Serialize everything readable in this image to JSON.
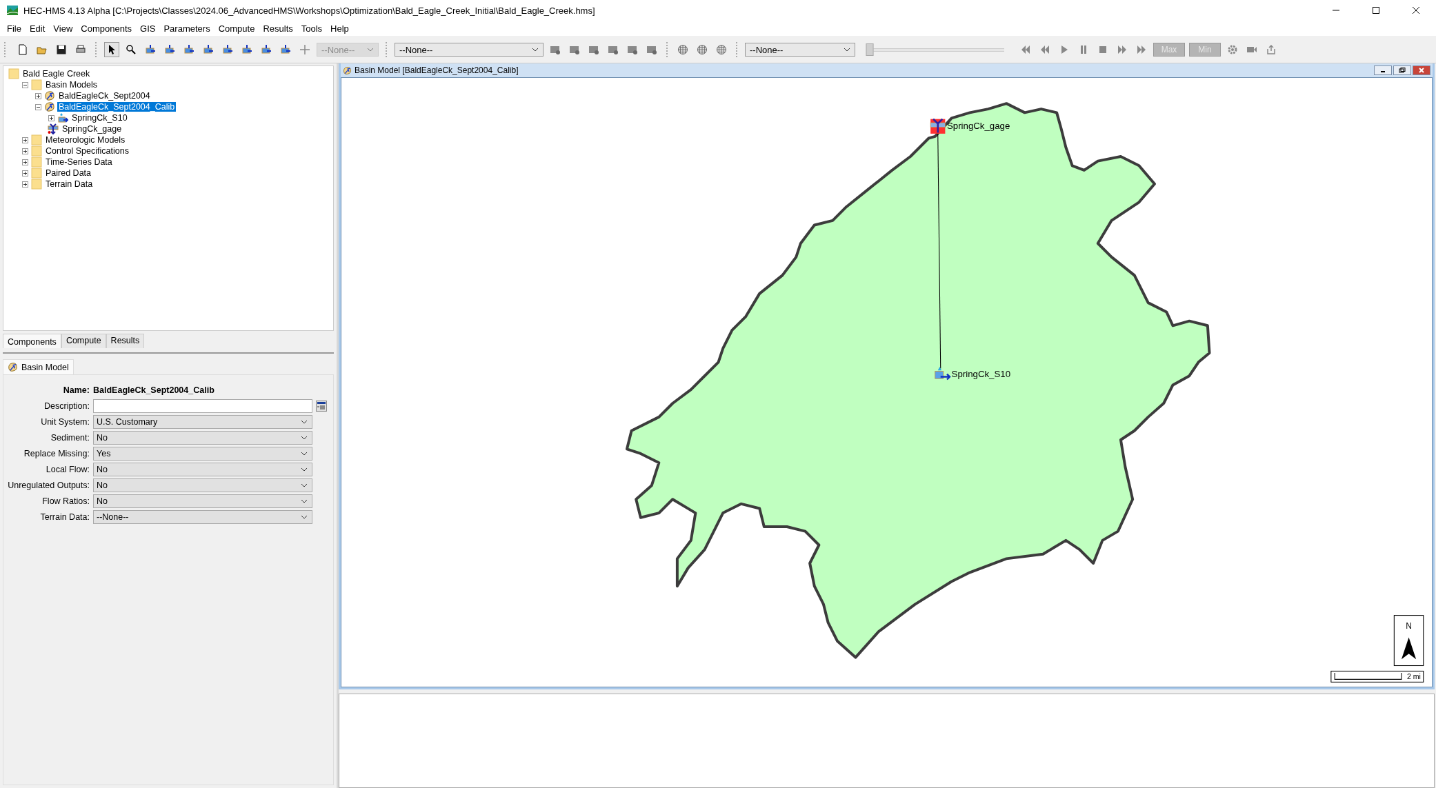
{
  "window": {
    "title": "HEC-HMS 4.13 Alpha [C:\\Projects\\Classes\\2024.06_AdvancedHMS\\Workshops\\Optimization\\Bald_Eagle_Creek_Initial\\Bald_Eagle_Creek.hms]"
  },
  "menu": [
    "File",
    "Edit",
    "View",
    "Components",
    "GIS",
    "Parameters",
    "Compute",
    "Results",
    "Tools",
    "Help"
  ],
  "toolbar": {
    "element_dropdown": {
      "value": "--None--",
      "disabled": true
    },
    "run_dropdown": {
      "value": "--None--",
      "disabled": false
    },
    "time_dropdown": {
      "value": "--None--",
      "disabled": false
    },
    "time_slider": {
      "level": 0
    },
    "max_button": {
      "label": "Max",
      "disabled": true
    },
    "min_button": {
      "label": "Min",
      "disabled": true
    }
  },
  "tree": [
    {
      "label": "Bald Eagle Creek",
      "kind": "folder",
      "selected": false,
      "children": [
        {
          "label": "Basin Models",
          "kind": "folder",
          "expanded": true,
          "selected": false,
          "children": [
            {
              "label": "BaldEagleCk_Sept2004",
              "kind": "basin",
              "expanded": false,
              "selected": false
            },
            {
              "label": "BaldEagleCk_Sept2004_Calib",
              "kind": "basin",
              "expanded": true,
              "selected": true,
              "children": [
                {
                  "label": "SpringCk_S10",
                  "kind": "subbasin",
                  "expanded": false,
                  "selected": false
                },
                {
                  "label": "SpringCk_gage",
                  "kind": "sink",
                  "selected": false
                }
              ]
            }
          ]
        },
        {
          "label": "Meteorologic Models",
          "kind": "folder",
          "expanded": false,
          "selected": false
        },
        {
          "label": "Control Specifications",
          "kind": "folder",
          "expanded": false,
          "selected": false
        },
        {
          "label": "Time-Series Data",
          "kind": "folder",
          "expanded": false,
          "selected": false
        },
        {
          "label": "Paired Data",
          "kind": "folder",
          "expanded": false,
          "selected": false
        },
        {
          "label": "Terrain Data",
          "kind": "folder",
          "expanded": false,
          "selected": false
        }
      ]
    }
  ],
  "tabs": [
    {
      "label": "Components",
      "selected": true
    },
    {
      "label": "Compute",
      "selected": false
    },
    {
      "label": "Results",
      "selected": false
    }
  ],
  "editor": {
    "tab": "Basin Model",
    "name_label": "Name:",
    "name_value": "BaldEagleCk_Sept2004_Calib",
    "fields": [
      {
        "label": "Description:",
        "kind": "text"
      },
      {
        "label": "Unit System:",
        "kind": "select",
        "value": "U.S. Customary"
      },
      {
        "label": "Sediment:",
        "kind": "select",
        "value": "No"
      },
      {
        "label": "Replace Missing:",
        "kind": "select",
        "value": "Yes"
      },
      {
        "label": "Local Flow:",
        "kind": "select",
        "value": "No"
      },
      {
        "label": "Unregulated Outputs:",
        "kind": "select",
        "value": "No"
      },
      {
        "label": "Flow Ratios:",
        "kind": "select",
        "value": "No"
      },
      {
        "label": "Terrain Data:",
        "kind": "select",
        "value": "--None--"
      }
    ]
  },
  "basin_window": {
    "title": "Basin Model [BaldEagleCk_Sept2004_Calib]",
    "elements": [
      {
        "label": "SpringCk_gage",
        "kind": "sink"
      },
      {
        "label": "SpringCk_S10",
        "kind": "subbasin"
      }
    ],
    "north_label": "N",
    "scale_label": "2 mi"
  }
}
